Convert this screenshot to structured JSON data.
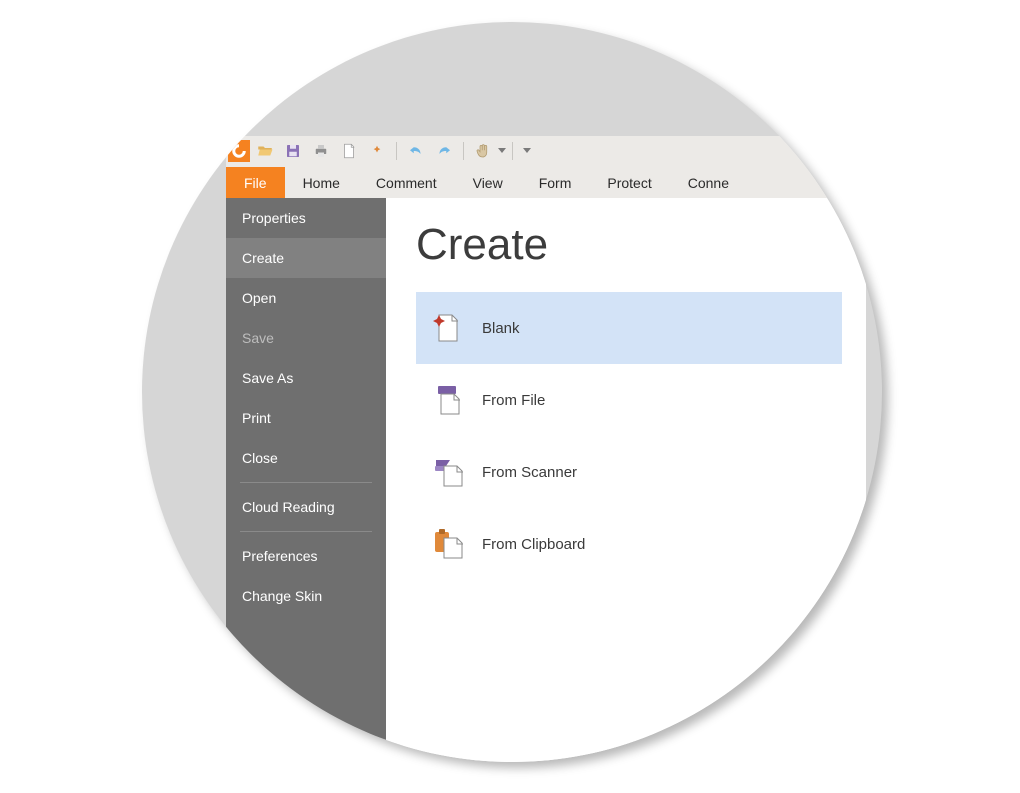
{
  "qat": {
    "tools": [
      {
        "name": "open-icon"
      },
      {
        "name": "save-icon"
      },
      {
        "name": "print-icon"
      },
      {
        "name": "page-icon"
      },
      {
        "name": "new-icon"
      },
      {
        "name": "undo-icon"
      },
      {
        "name": "redo-icon"
      },
      {
        "name": "hand-icon"
      }
    ]
  },
  "tabs": [
    "File",
    "Home",
    "Comment",
    "View",
    "Form",
    "Protect",
    "Conne"
  ],
  "sidebar": {
    "groups": [
      [
        "Properties",
        "Create",
        "Open",
        "Save",
        "Save As",
        "Print",
        "Close"
      ],
      [
        "Cloud Reading"
      ],
      [
        "Preferences",
        "Change Skin"
      ]
    ],
    "selected": "Create",
    "disabled": [
      "Save"
    ]
  },
  "content": {
    "title": "Create",
    "options": [
      {
        "label": "Blank",
        "icon": "blank",
        "selected": true
      },
      {
        "label": "From File",
        "icon": "file",
        "selected": false
      },
      {
        "label": "From Scanner",
        "icon": "scanner",
        "selected": false
      },
      {
        "label": "From Clipboard",
        "icon": "clipboard",
        "selected": false
      }
    ]
  },
  "colors": {
    "accent": "#f58220",
    "sidebar": "#6f6f6f",
    "selection": "#d3e3f7"
  }
}
